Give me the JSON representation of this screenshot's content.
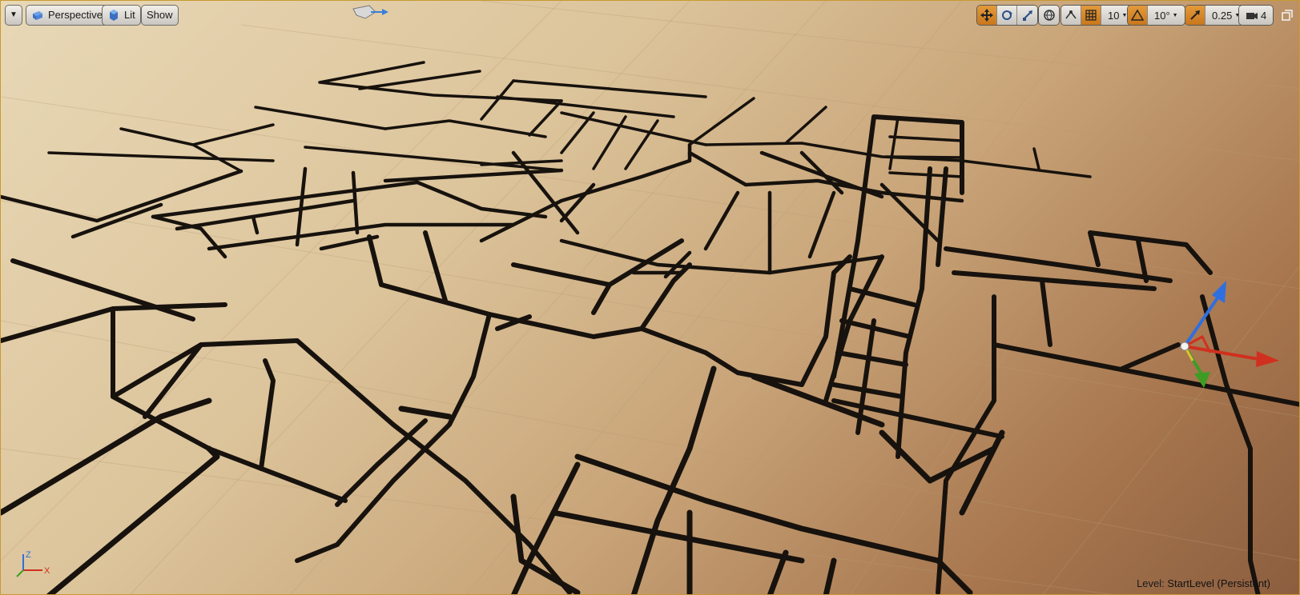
{
  "toolbar": {
    "menu_icon": "chevron-down-icon",
    "perspective_label": "Perspective",
    "lit_label": "Lit",
    "show_label": "Show",
    "grid_snap_value": "10",
    "rotation_snap_value": "10°",
    "scale_snap_value": "0.25",
    "camera_speed_value": "4"
  },
  "status": {
    "level_prefix": "Level:",
    "level_name": "StartLevel (Persistent)"
  },
  "axis_indicator": {
    "z": "Z",
    "x": "X"
  },
  "colors": {
    "accent": "#c9771c",
    "border": "#c89a2f",
    "road": "#17120d",
    "gizmo_x": "#d0301f",
    "gizmo_y": "#3e9c25",
    "gizmo_z": "#2f6fe0"
  }
}
